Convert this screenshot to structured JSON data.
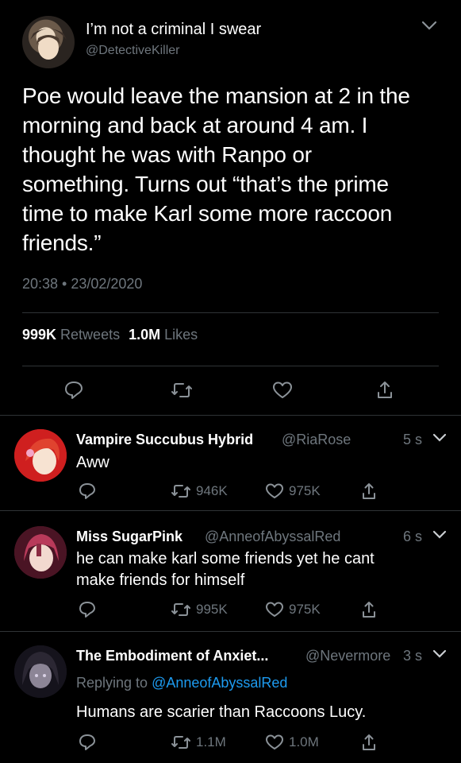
{
  "main_tweet": {
    "display_name": "I’m not a criminal I swear",
    "handle": "@DetectiveKiller",
    "text": "Poe would leave the mansion at 2 in the morning and back at around 4 am. I thought he was with Ranpo or something. Turns out “that’s the prime time to make Karl some more raccoon friends.”",
    "lines": [
      "Poe would leave the mansion at 2 in the",
      "morning and back at around 4 am. I",
      "thought he was with Ranpo or",
      "something. Turns out “that’s the prime",
      "time to make Karl some more raccoon",
      "friends.”"
    ],
    "timestamp": "20:38 • 23/02/2020",
    "retweets_count": "999K",
    "retweets_label": "Retweets",
    "likes_count": "1.0M",
    "likes_label": "Likes"
  },
  "replies": [
    {
      "display_name": "Vampire Succubus Hybrid",
      "handle": "@RiaRose",
      "time": "5 s",
      "text_lines": [
        "Aww"
      ],
      "retweets": "946K",
      "likes": "975K"
    },
    {
      "display_name": "Miss SugarPink",
      "handle": "@AnneofAbyssalRed",
      "time": "6 s",
      "text_lines": [
        "he can make karl some friends yet he cant",
        "make friends for himself"
      ],
      "retweets": "995K",
      "likes": "975K"
    },
    {
      "display_name": "The Embodiment of Anxiet...",
      "handle": "@Nevermore",
      "time": "3 s",
      "replying_to_label": "Replying to",
      "replying_to_handle": "@AnneofAbyssalRed",
      "text_lines": [
        "Humans are scarier than Raccoons Lucy."
      ],
      "retweets": "1.1M",
      "likes": "1.0M"
    }
  ],
  "colors": {
    "background": "#000000",
    "secondary_text": "#6e767d",
    "link": "#1d9bf0",
    "divider": "#2f3336"
  },
  "icons": [
    "chevron-down-icon",
    "reply-icon",
    "retweet-icon",
    "like-icon",
    "share-icon"
  ]
}
